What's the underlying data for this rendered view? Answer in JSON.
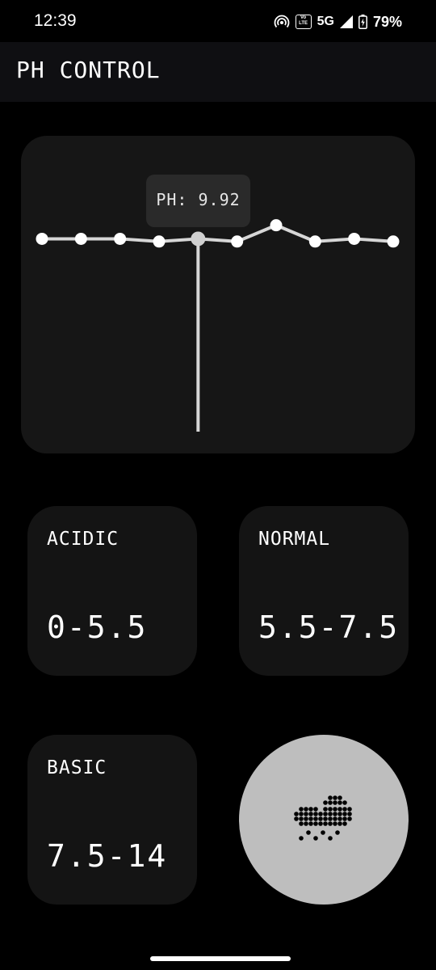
{
  "status_bar": {
    "time": "12:39",
    "network": "5G",
    "volte": "Vo LTE",
    "battery": "79%"
  },
  "app_bar": {
    "title": "PH CONTROL"
  },
  "chart": {
    "tooltip": "PH: 9.92",
    "selected_index": 4,
    "colors": {
      "line": "#d6d6d6",
      "point": "#ffffff",
      "selected_point": "#d0d0d0",
      "indicator": "#d6d6d6"
    }
  },
  "chart_data": {
    "type": "line",
    "x": [
      1,
      2,
      3,
      4,
      5,
      6,
      7,
      8,
      9,
      10
    ],
    "series": [
      {
        "values": [
          9.92,
          9.92,
          9.92,
          9.9,
          9.92,
          9.9,
          10.02,
          9.9,
          9.92,
          9.9
        ]
      }
    ],
    "ylim": [
      8.5,
      10.5
    ],
    "grid": false
  },
  "ranges": {
    "acidic": {
      "name": "ACIDIC",
      "value": "0-5.5"
    },
    "normal": {
      "name": "NORMAL",
      "value": "5.5-7.5"
    },
    "basic": {
      "name": "BASIC",
      "value": "7.5-14"
    }
  },
  "weather_button": {
    "icon": "rain-cloud-icon"
  }
}
